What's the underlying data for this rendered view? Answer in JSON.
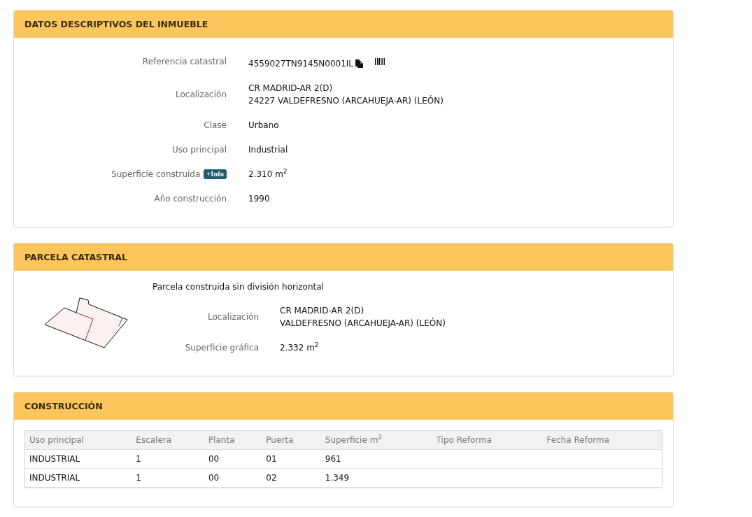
{
  "datos_descriptivos": {
    "title": "DATOS DESCRIPTIVOS DEL INMUEBLE",
    "fields": [
      {
        "kind": "reference",
        "label": "Referencia catastral",
        "lines": [
          "4559027TN9145N0001IL"
        ]
      },
      {
        "kind": "text",
        "label": "Localización",
        "lines": [
          "CR MADRID-AR 2(D)",
          "24227 VALDEFRESNO (ARCAHUEJA-AR) (LEÓN)"
        ]
      },
      {
        "kind": "text",
        "label": "Clase",
        "lines": [
          "Urbano"
        ]
      },
      {
        "kind": "text",
        "label": "Uso principal",
        "lines": [
          "Industrial"
        ]
      },
      {
        "kind": "text",
        "label": "Superficie construida",
        "badge": "+Info",
        "lines": [
          "2.310 m$^{2}$"
        ]
      },
      {
        "kind": "text",
        "label": "Año construcción",
        "lines": [
          "1990"
        ]
      }
    ]
  },
  "parcela_catastral": {
    "title": "PARCELA CATASTRAL",
    "description": "Parcela construida sin división horizontal",
    "fields": [
      {
        "label": "Localización",
        "lines": [
          "CR MADRID-AR 2(D)",
          "VALDEFRESNO (ARCAHUEJA-AR) (LEÓN)"
        ]
      },
      {
        "label": "Superficie gráfica",
        "lines": [
          "2.332 m$^{2}$"
        ]
      }
    ]
  },
  "construccion": {
    "title": "CONSTRUCCIÓN",
    "table": {
      "columns": [
        "Uso principal",
        "Escalera",
        "Planta",
        "Puerta",
        "Superficie m$^{2}$",
        "Tipo Reforma",
        "Fecha Reforma"
      ],
      "rows": [
        [
          "INDUSTRIAL",
          "1",
          "00",
          "01",
          "961"
        ],
        [
          "INDUSTRIAL",
          "1",
          "00",
          "02",
          "1.349"
        ]
      ]
    }
  }
}
